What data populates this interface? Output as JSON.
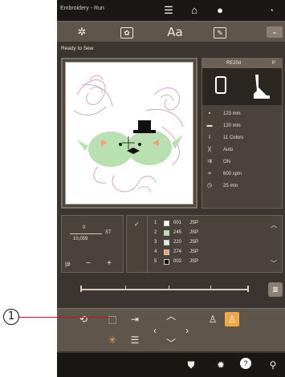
{
  "callout": {
    "number": "1"
  },
  "titlebar": {
    "title": "Embroidery - Run",
    "icons": [
      "menu-icon",
      "home-icon",
      "stop-icon",
      "wifi-icon"
    ]
  },
  "toolbar": {
    "buttons": [
      {
        "name": "sparkle-tool",
        "glyph": "✲"
      },
      {
        "name": "pattern-tool",
        "glyph": "✿"
      },
      {
        "name": "text-tool",
        "label": "Aa"
      },
      {
        "name": "edit-tool",
        "glyph": "✎"
      },
      {
        "name": "collapse-button",
        "glyph": "⌄"
      }
    ]
  },
  "status": {
    "text": "Ready to Sew"
  },
  "info": {
    "frame": "RE20d",
    "presser": "P",
    "rows": [
      {
        "icon": "▪",
        "value": "123 mm"
      },
      {
        "icon": "▬",
        "value": "120 mm"
      },
      {
        "icon": "I",
        "value": "11 Colors"
      },
      {
        "icon": ")(",
        "value": "Auto"
      },
      {
        "icon": "⇉",
        "value": "ON"
      },
      {
        "icon": "≁",
        "value": "600 spm"
      },
      {
        "icon": "◷",
        "value": "25 min"
      }
    ]
  },
  "stitches": {
    "current": "0",
    "unit": "ST",
    "total": "10,059",
    "minus": "−",
    "plus": "+",
    "jump_icon": "|#"
  },
  "colors": {
    "rows": [
      {
        "n": "1",
        "code": "001",
        "brand": "JSP",
        "color": "#ffffff"
      },
      {
        "n": "2",
        "code": "245",
        "brand": "JSP",
        "color": "#b9e0b0"
      },
      {
        "n": "3",
        "code": "220",
        "brand": "JSP",
        "color": "#e8e8e8"
      },
      {
        "n": "4",
        "code": "274",
        "brand": "JSP",
        "color": "#f3a06a"
      },
      {
        "n": "5",
        "code": "002",
        "brand": "JSP",
        "color": "#111111"
      }
    ]
  },
  "accent": "#f0a94a"
}
